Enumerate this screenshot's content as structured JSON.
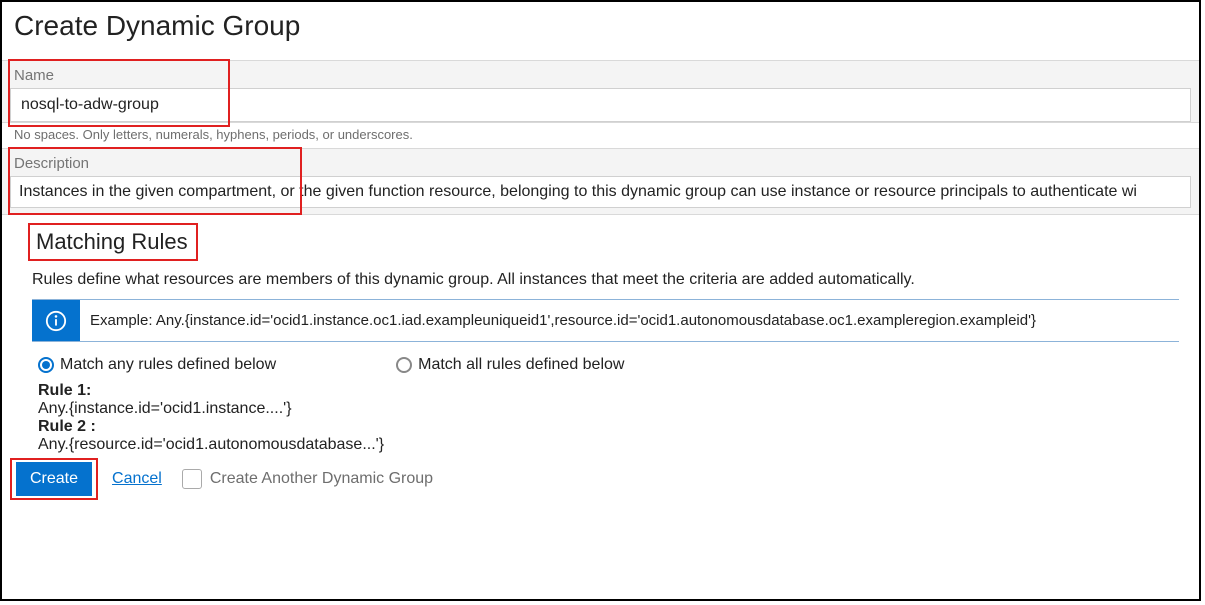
{
  "page_title": "Create Dynamic Group",
  "name_field": {
    "label": "Name",
    "value": "nosql-to-adw-group",
    "hint": "No spaces. Only letters, numerals, hyphens, periods, or underscores."
  },
  "description_field": {
    "label": "Description",
    "value": "Instances in the given compartment, or the given function resource, belonging to this dynamic group can use instance or resource principals to authenticate wi"
  },
  "matching_rules": {
    "title": "Matching Rules",
    "description": "Rules define what resources are members of this dynamic group. All instances that meet the criteria are added automatically.",
    "example": "Example: Any.{instance.id='ocid1.instance.oc1.iad.exampleuniqueid1',resource.id='ocid1.autonomousdatabase.oc1.exampleregion.exampleid'}",
    "match_any_label": "Match any rules defined below",
    "match_all_label": "Match all rules defined below",
    "selected_mode": "any",
    "rules": [
      {
        "label": "Rule 1:",
        "body": "Any.{instance.id='ocid1.instance....'}"
      },
      {
        "label": "Rule 2 :",
        "body": "Any.{resource.id='ocid1.autonomousdatabase...'}"
      }
    ]
  },
  "footer": {
    "create_label": "Create",
    "cancel_label": "Cancel",
    "create_another_label": "Create Another Dynamic Group"
  },
  "colors": {
    "primary": "#0572ce",
    "highlight_border": "#e02020"
  }
}
